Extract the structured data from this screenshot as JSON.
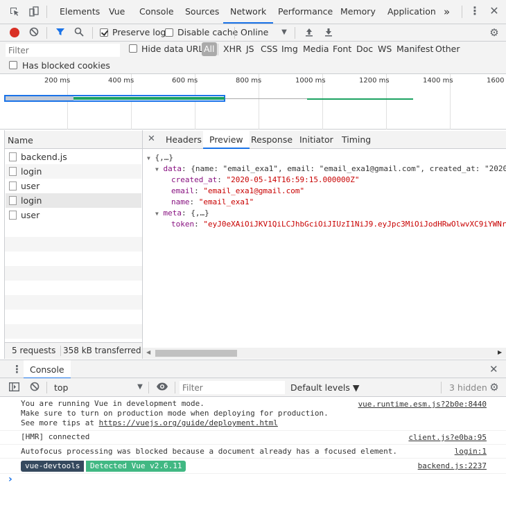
{
  "top_tabs": [
    "Elements",
    "Vue",
    "Console",
    "Sources",
    "Network",
    "Performance",
    "Memory",
    "Application"
  ],
  "top_tab_active": "Network",
  "more_tabs": "»",
  "toolbar": {
    "preserve_log": "Preserve log",
    "disable_cache": "Disable cache",
    "throttling": "Online"
  },
  "filter": {
    "placeholder": "Filter",
    "hide_data_urls": "Hide data URLs",
    "types": [
      "All",
      "XHR",
      "JS",
      "CSS",
      "Img",
      "Media",
      "Font",
      "Doc",
      "WS",
      "Manifest",
      "Other"
    ],
    "has_blocked_cookies": "Has blocked cookies"
  },
  "timeline": {
    "ticks": [
      "200 ms",
      "400 ms",
      "600 ms",
      "800 ms",
      "1000 ms",
      "1200 ms",
      "1400 ms",
      "1600"
    ]
  },
  "requests": {
    "header": "Name",
    "items": [
      "backend.js",
      "login",
      "user",
      "login",
      "user"
    ],
    "summary_requests": "5 requests",
    "summary_transferred": "358 kB transferred"
  },
  "detail_tabs": [
    "Headers",
    "Preview",
    "Response",
    "Initiator",
    "Timing"
  ],
  "detail_active": "Preview",
  "preview": {
    "root": "{,…}",
    "data_key": "data",
    "data_summary": "{name: \"email_exa1\", email: \"email_exa1@gmail.com\", created_at: \"2020",
    "created_at_key": "created_at",
    "created_at_val": "\"2020-05-14T16:59:15.000000Z\"",
    "email_key": "email",
    "email_val": "\"email_exa1@gmail.com\"",
    "name_key": "name",
    "name_val": "\"email_exa1\"",
    "meta_key": "meta",
    "meta_summary": "{,…}",
    "token_key": "token",
    "token_val": "\"eyJ0eXAiOiJKV1QiLCJhbGciOiJIUzI1NiJ9.eyJpc3MiOiJodHRwOlwvXC9iYWNr"
  },
  "drawer": {
    "tab": "Console",
    "context": "top",
    "filter_placeholder": "Filter",
    "levels": "Default levels ▼",
    "hidden": "3 hidden"
  },
  "console": {
    "vue_msg_1": "You are running Vue in development mode.",
    "vue_msg_2": "Make sure to turn on production mode when deploying for production.",
    "vue_msg_3_prefix": "See more tips at ",
    "vue_msg_3_link": "https://vuejs.org/guide/deployment.html",
    "vue_src": "vue.runtime.esm.js?2b0e:8440",
    "hmr_msg": "[HMR] connected",
    "hmr_src": "client.js?e0ba:95",
    "autofocus_msg": "Autofocus processing was blocked because a document already has a focused element.",
    "autofocus_src": "login:1",
    "devtools_badge": "vue-devtools",
    "devtools_detected": "Detected Vue v2.6.11",
    "devtools_src": "backend.js:2237",
    "prompt": "›"
  }
}
